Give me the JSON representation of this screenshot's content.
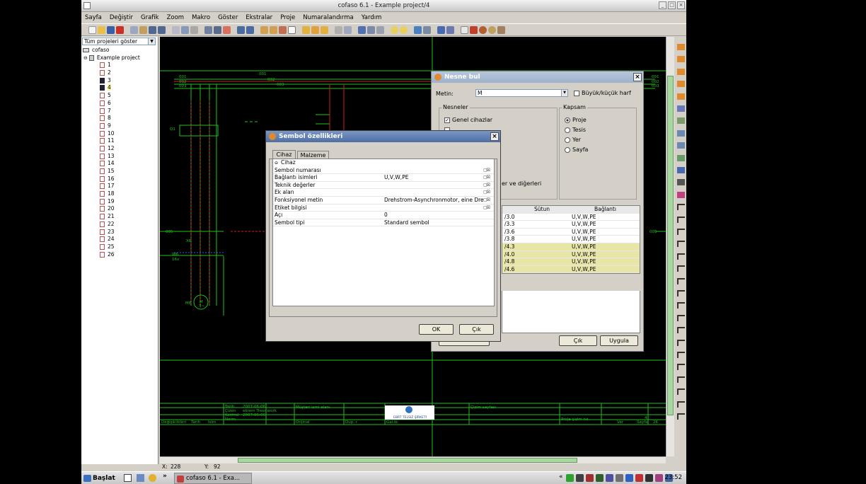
{
  "window": {
    "title": "cofaso 6.1 - Example project/4"
  },
  "menu": [
    "Sayfa",
    "Değiştir",
    "Grafik",
    "Zoom",
    "Makro",
    "Göster",
    "Ekstralar",
    "Proje",
    "Numaralandırma",
    "Yardım"
  ],
  "project_panel": {
    "filter": "Tüm projeleri göster",
    "root": "cofaso",
    "project": "Example project",
    "pages": [
      "1",
      "2",
      "3",
      "4",
      "5",
      "6",
      "7",
      "8",
      "9",
      "10",
      "11",
      "12",
      "13",
      "14",
      "15",
      "16",
      "17",
      "18",
      "19",
      "20",
      "21",
      "22",
      "23",
      "24",
      "25",
      "26"
    ]
  },
  "status": {
    "x_label": "X:",
    "x": "228",
    "y_label": "Y:",
    "y": "92"
  },
  "drawing": {
    "net_labels": [
      "001",
      "002",
      "003",
      "001",
      "002",
      "003",
      "001",
      "002",
      "003",
      "005",
      "005"
    ],
    "labels": [
      "Q1",
      "X6",
      "M6",
      "W6",
      "16x",
      "M",
      "3~"
    ],
    "titleblock": {
      "rows": [
        "Tarih",
        "Çizen",
        "Kontrol",
        "Norm"
      ],
      "dates": [
        "2007-06-06",
        "2007-06-06"
      ],
      "name": "ekrem Treer work",
      "customer": "Müşteri ismi alanı",
      "origin": "Orijinal",
      "ersetzt": "Dup. r.",
      "basis": "Gal.ib.",
      "sheet": "Çizim sayfası",
      "drawing_no": "Proje çizim no.",
      "change": "Değişiklikleri",
      "date": "Tarih",
      "name_col": "İsim",
      "list": "Ver",
      "page_lbl": "Sayfa",
      "page_n": "4",
      "page_total": "26",
      "logo": "EBRT TELSIZ ŞİRKETİ"
    }
  },
  "find_dialog": {
    "title": "Nesne bul",
    "text_label": "Metin:",
    "text_value": "M",
    "case_label": "Büyük/küçük harf",
    "objects_group": "Nesneler",
    "obj_device": "Genel cihazlar",
    "obj_partial": "...",
    "other": "er ve diğerleri",
    "scope_group": "Kapsam",
    "scope": [
      "Proje",
      "Tesis",
      "Yer",
      "Sayfa"
    ],
    "col_column": "Sütun",
    "col_connection": "Bağlantı",
    "results": [
      {
        "col": "/3.0",
        "conn": "U,V,W,PE"
      },
      {
        "col": "/3.3",
        "conn": "U,V,W,PE"
      },
      {
        "col": "/3.6",
        "conn": "U,V,W,PE"
      },
      {
        "col": "/3.8",
        "conn": "U,V,W,PE"
      },
      {
        "col": "/4.3",
        "conn": "U,V,W,PE"
      },
      {
        "col": "/4.0",
        "conn": "U,V,W,PE"
      },
      {
        "col": "/4.8",
        "conn": "U,V,W,PE"
      },
      {
        "col": "/4.6",
        "conn": "U,V,W,PE"
      }
    ],
    "close": "Çık",
    "apply": "Uygula"
  },
  "symbol_dialog": {
    "title": "Sembol özellikleri",
    "tabs": [
      "Cihaz",
      "Malzeme"
    ],
    "group": "Cihaz",
    "props": [
      {
        "key": "Sembol numarası",
        "value": ""
      },
      {
        "key": "Bağlantı isimleri",
        "value": "U,V,W,PE"
      },
      {
        "key": "Teknik değerler",
        "value": ""
      },
      {
        "key": "Ek alan",
        "value": ""
      },
      {
        "key": "Fonksiyonel metin",
        "value": "Drehstrom-Asynchronmotor, eine Dreh"
      },
      {
        "key": "Etiket bilgisi",
        "value": ""
      },
      {
        "key": "Açı",
        "value": "0"
      },
      {
        "key": "Sembol tipi",
        "value": "Standard sembol"
      }
    ],
    "ok": "OK",
    "cancel": "Çık"
  },
  "taskbar": {
    "start": "Başlat",
    "task": "cofaso 6.1 - Exa...",
    "clock": "23:52",
    "arrows": "»",
    "chev": "«"
  }
}
